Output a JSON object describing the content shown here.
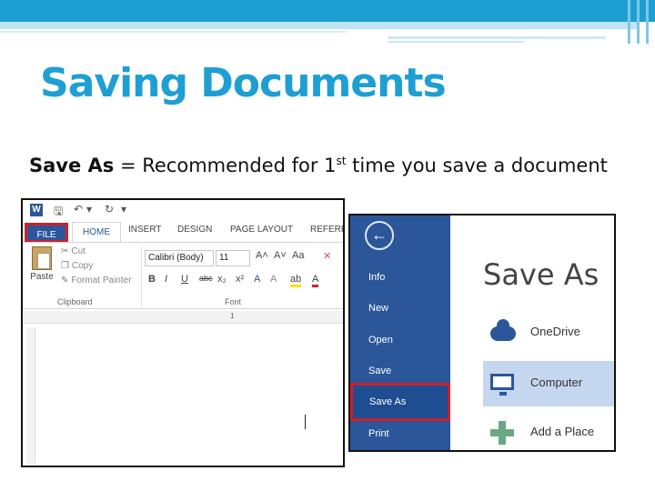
{
  "slide": {
    "title": "Saving Documents",
    "subtitle_bold": "Save As",
    "subtitle_mid": " = Recommended for 1",
    "subtitle_sup": "st",
    "subtitle_end": " time you save a document"
  },
  "word": {
    "tabs": [
      "FILE",
      "HOME",
      "INSERT",
      "DESIGN",
      "PAGE LAYOUT",
      "REFEREN"
    ],
    "paste_label": "Paste",
    "clipboard_items": [
      "Cut",
      "Copy",
      "Format Painter"
    ],
    "clipboard_group": "Clipboard",
    "font_name": "Calibri (Body)",
    "font_size": "11",
    "font_group": "Font",
    "format_buttons": [
      "B",
      "I",
      "U",
      "abc",
      "x₂",
      "x²",
      "A",
      "A",
      "ab",
      "A"
    ],
    "ruler_mark": "1"
  },
  "backstage": {
    "nav_items": [
      "Info",
      "New",
      "Open",
      "Save",
      "Save As",
      "Print"
    ],
    "title": "Save As",
    "places": [
      "OneDrive",
      "Computer",
      "Add a Place"
    ],
    "colors": {
      "nav": "#2b579a",
      "highlight": "#d0202a",
      "selected": "#c5d7ef"
    }
  }
}
